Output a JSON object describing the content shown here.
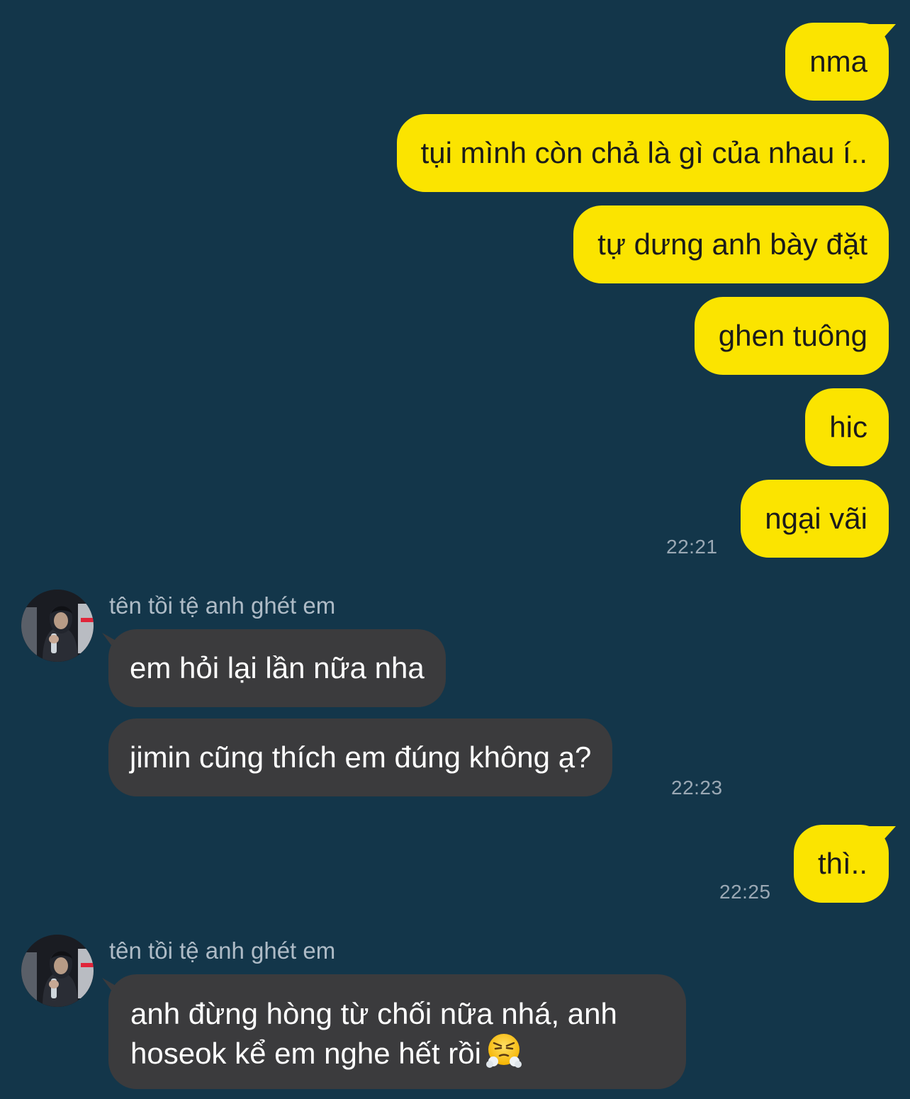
{
  "outgoing_group_1": {
    "messages": [
      "nma",
      "tụi mình còn chả là gì của nhau í..",
      "tự dưng anh bày đặt",
      "ghen tuông",
      "hic",
      "ngại vãi"
    ],
    "time": "22:21"
  },
  "incoming_group_1": {
    "sender": "tên tồi tệ anh ghét em",
    "messages": [
      "em hỏi lại lần nữa nha",
      "jimin cũng thích em đúng không ạ?"
    ],
    "time": "22:23"
  },
  "outgoing_group_2": {
    "messages": [
      "thì.."
    ],
    "time": "22:25"
  },
  "incoming_group_2": {
    "sender": "tên tồi tệ anh ghét em",
    "message_line_1": "anh đừng hòng từ chối nữa nhá, anh",
    "message_line_2": "hoseok kể em nghe hết rồi",
    "emoji": "face-with-steam-emoji"
  },
  "colors": {
    "background": "#13364a",
    "outgoing_bubble": "#fbe400",
    "incoming_bubble": "#3b3b3d",
    "timestamp": "#9aa8b4",
    "sender_name": "#aebbc6"
  }
}
